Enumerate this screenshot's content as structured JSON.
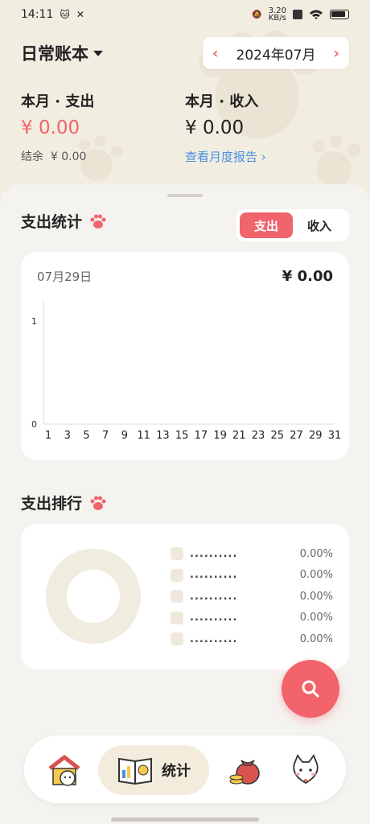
{
  "status_bar": {
    "time": "14:11",
    "speed_value": "3.20",
    "speed_unit": "KB/s"
  },
  "header": {
    "book_title": "日常账本",
    "month": "2024年07月",
    "prev_icon": "chevron-left-icon",
    "next_icon": "chevron-right-icon"
  },
  "summary": {
    "expense_label": "本月 · 支出",
    "expense_amount": "¥ 0.00",
    "balance_label": "结余",
    "balance_amount": "¥ 0.00",
    "income_label": "本月 · 收入",
    "income_amount": "¥ 0.00",
    "report_link": "查看月度报告 ›"
  },
  "stats": {
    "title": "支出统计",
    "toggle": {
      "expense": "支出",
      "income": "收入",
      "selected": "支出"
    }
  },
  "chart_data": {
    "type": "line",
    "title": "",
    "date_label": "07月29日",
    "total": "¥ 0.00",
    "x_ticks": [
      "1",
      "3",
      "5",
      "7",
      "9",
      "11",
      "13",
      "15",
      "17",
      "19",
      "21",
      "23",
      "25",
      "27",
      "29",
      "31"
    ],
    "y_ticks": [
      "0",
      "1"
    ],
    "ylim": [
      0,
      1
    ],
    "xlim": [
      1,
      31
    ],
    "series": []
  },
  "ranking": {
    "title": "支出排行",
    "items": [
      {
        "name": "..........",
        "percent": "0.00%"
      },
      {
        "name": "..........",
        "percent": "0.00%"
      },
      {
        "name": "..........",
        "percent": "0.00%"
      },
      {
        "name": "..........",
        "percent": "0.00%"
      },
      {
        "name": "..........",
        "percent": "0.00%"
      }
    ]
  },
  "nav": {
    "active_label": "统计"
  },
  "colors": {
    "accent": "#f0646c",
    "background": "#f2ede1",
    "sheet": "#f5f3ef",
    "link": "#4a8fe0"
  }
}
